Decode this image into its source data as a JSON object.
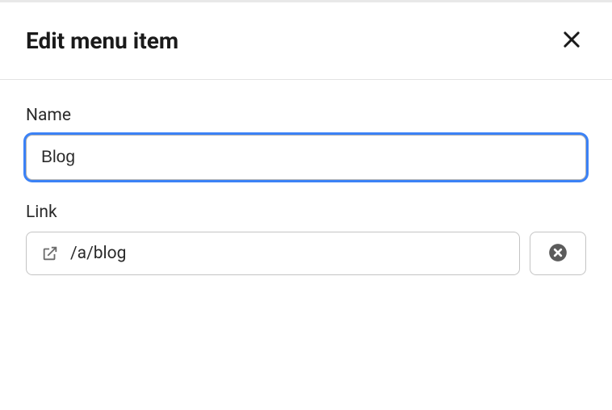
{
  "dialog": {
    "title": "Edit menu item"
  },
  "fields": {
    "name": {
      "label": "Name",
      "value": "Blog"
    },
    "link": {
      "label": "Link",
      "value": "/a/blog"
    }
  }
}
